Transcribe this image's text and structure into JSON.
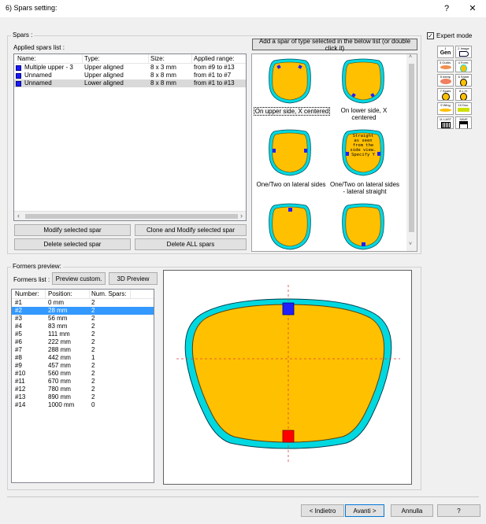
{
  "window": {
    "title": "6) Spars setting:",
    "help": "?",
    "close": "✕"
  },
  "spars": {
    "group_label": "Spars :",
    "applied_label": "Applied spars list :",
    "columns": [
      "Name:",
      "Type:",
      "Size:",
      "Applied range:"
    ],
    "rows": [
      {
        "name": "Multiple upper - 3",
        "type": "Upper aligned",
        "size": "8 x 3 mm",
        "range": "from #9 to #13"
      },
      {
        "name": "Unnamed",
        "type": "Upper aligned",
        "size": "8 x 8 mm",
        "range": "from #1 to #7"
      },
      {
        "name": "Unnamed",
        "type": "Lower aligned",
        "size": "8 x 8 mm",
        "range": "from #1 to #13"
      }
    ],
    "buttons": {
      "modify": "Modify selected spar",
      "clone": "Clone and Modify selected spar",
      "delete": "Delete selected spar",
      "delete_all": "Delete ALL spars"
    },
    "add_button": "Add a spar of  type selected in the below list (or double click it)",
    "types": [
      "On upper side, X centered",
      "On lower side, X centered",
      "One/Two on lateral sides",
      "One/Two on lateral sides - lateral straight"
    ],
    "straight_text": "Straight as seen from the side view. Specify Y"
  },
  "expert": {
    "label": "Expert mode",
    "checked": true
  },
  "toolbox": [
    {
      "label": "1",
      "title": "Gen"
    },
    {
      "label": "2 Image",
      "title": ""
    },
    {
      "label": "3 Outlin.",
      "title": ""
    },
    {
      "label": "4 Form.",
      "title": ""
    },
    {
      "label": "5 Interp",
      "title": ""
    },
    {
      "label": "6 Sheet",
      "title": ""
    },
    {
      "label": "7 Spars",
      "title": ""
    },
    {
      "label": "8 L.H.",
      "title": ""
    },
    {
      "label": "9 Wing",
      "title": ""
    },
    {
      "label": "10 Doc.",
      "title": ""
    },
    {
      "label": "11 LAST",
      "title": ""
    },
    {
      "label": "SAVE",
      "title": ""
    }
  ],
  "formers": {
    "group_label": "Formers preview:",
    "list_label": "Formers list :",
    "preview_custom": "Preview custom.",
    "preview_3d": "3D Preview",
    "columns": [
      "Number:",
      "Position:",
      "Num. Spars:"
    ],
    "rows": [
      {
        "n": "#1",
        "pos": "0 mm",
        "spars": "2"
      },
      {
        "n": "#2",
        "pos": "28 mm",
        "spars": "2"
      },
      {
        "n": "#3",
        "pos": "56 mm",
        "spars": "2"
      },
      {
        "n": "#4",
        "pos": "83 mm",
        "spars": "2"
      },
      {
        "n": "#5",
        "pos": "111 mm",
        "spars": "2"
      },
      {
        "n": "#6",
        "pos": "222 mm",
        "spars": "2"
      },
      {
        "n": "#7",
        "pos": "288 mm",
        "spars": "2"
      },
      {
        "n": "#8",
        "pos": "442 mm",
        "spars": "1"
      },
      {
        "n": "#9",
        "pos": "457 mm",
        "spars": "2"
      },
      {
        "n": "#10",
        "pos": "560 mm",
        "spars": "2"
      },
      {
        "n": "#11",
        "pos": "670 mm",
        "spars": "2"
      },
      {
        "n": "#12",
        "pos": "780 mm",
        "spars": "2"
      },
      {
        "n": "#13",
        "pos": "890 mm",
        "spars": "2"
      },
      {
        "n": "#14",
        "pos": "1000 mm",
        "spars": "0"
      }
    ],
    "selected_index": 1
  },
  "footer": {
    "back": "< Indietro",
    "next": "Avanti >",
    "cancel": "Annulla",
    "help": "?"
  },
  "colors": {
    "fill": "#ffc000",
    "outline": "#00d8e0",
    "spar_top": "#2020ff",
    "spar_bottom": "#ff0000"
  }
}
